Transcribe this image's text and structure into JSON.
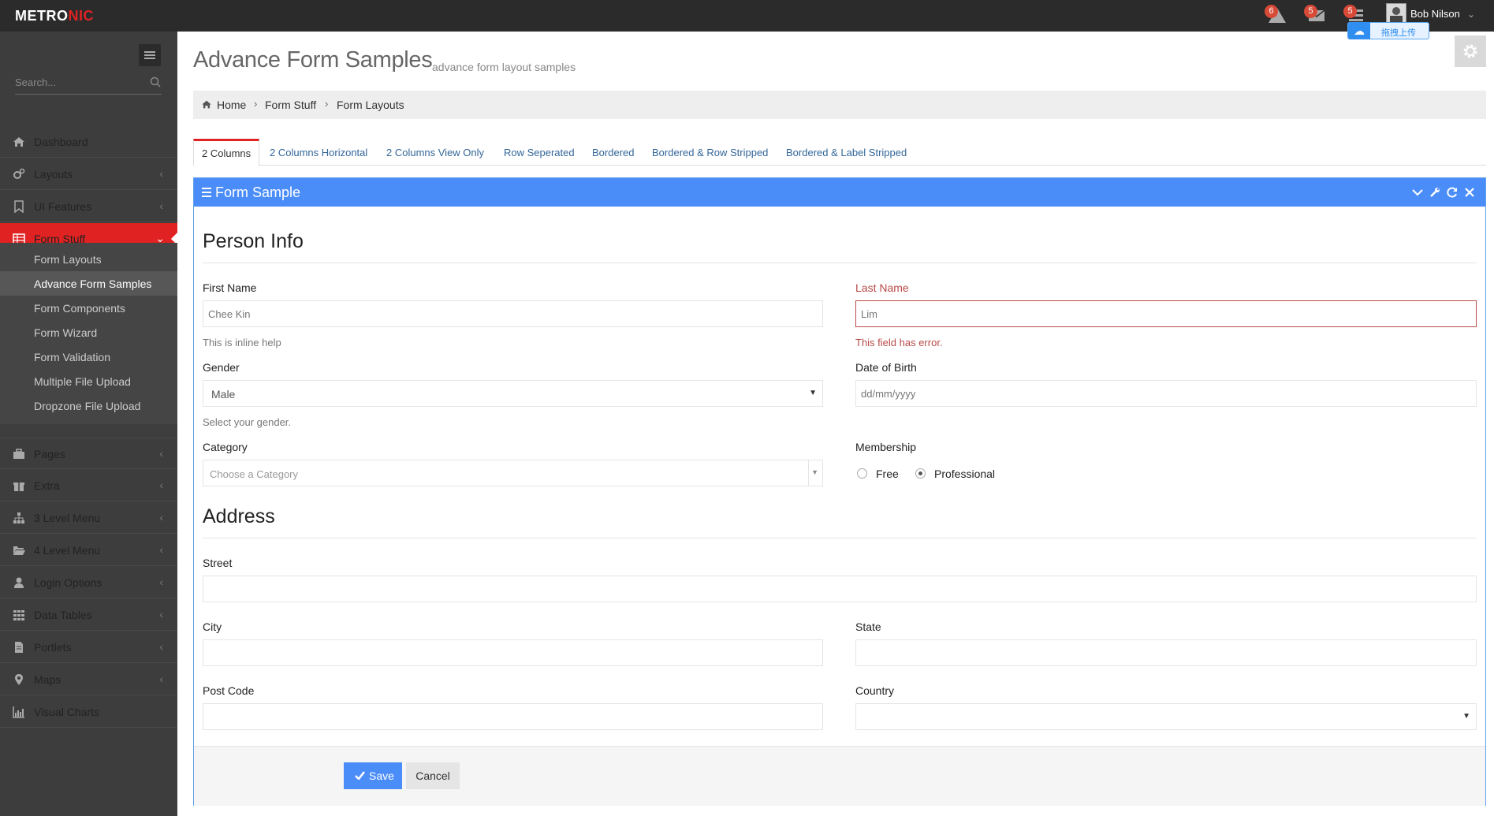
{
  "header": {
    "logo_part1": "METRO",
    "logo_part2": "NIC",
    "notifications": [
      {
        "icon": "warning-icon",
        "count": "6"
      },
      {
        "icon": "envelope-icon",
        "count": "5"
      },
      {
        "icon": "tasks-icon",
        "count": "5"
      }
    ],
    "user_name": "Bob Nilson",
    "upload_tooltip": "拖拽上传"
  },
  "sidebar": {
    "search_placeholder": "Search...",
    "items": [
      {
        "label": "Dashboard",
        "icon": "home-icon"
      },
      {
        "label": "Layouts",
        "icon": "cogs-icon"
      },
      {
        "label": "UI Features",
        "icon": "bookmark-icon"
      },
      {
        "label": "Form Stuff",
        "icon": "table-icon"
      },
      {
        "label": "Pages",
        "icon": "briefcase-icon"
      },
      {
        "label": "Extra",
        "icon": "gift-icon"
      },
      {
        "label": "3 Level Menu",
        "icon": "sitemap-icon"
      },
      {
        "label": "4 Level Menu",
        "icon": "folder-open-icon"
      },
      {
        "label": "Login Options",
        "icon": "user-icon"
      },
      {
        "label": "Data Tables",
        "icon": "th-icon"
      },
      {
        "label": "Portlets",
        "icon": "file-text-icon"
      },
      {
        "label": "Maps",
        "icon": "map-marker-icon"
      },
      {
        "label": "Visual Charts",
        "icon": "bar-chart-icon"
      }
    ],
    "submenu": [
      "Form Layouts",
      "Advance Form Samples",
      "Form Components",
      "Form Wizard",
      "Form Validation",
      "Multiple File Upload",
      "Dropzone File Upload"
    ]
  },
  "page": {
    "title": "Advance Form Samples",
    "subtitle": "advance form layout samples"
  },
  "breadcrumb": [
    "Home",
    "Form Stuff",
    "Form Layouts"
  ],
  "tabs": [
    "2 Columns",
    "2 Columns Horizontal",
    "2 Columns View Only",
    "Row Seperated",
    "Bordered",
    "Bordered & Row Stripped",
    "Bordered & Label Stripped"
  ],
  "portlet": {
    "title": "Form Sample"
  },
  "form": {
    "person_info_title": "Person Info",
    "first_name_label": "First Name",
    "first_name_placeholder": "Chee Kin",
    "first_name_help": "This is inline help",
    "last_name_label": "Last Name",
    "last_name_placeholder": "Lim",
    "last_name_help": "This field has error.",
    "gender_label": "Gender",
    "gender_value": "Male",
    "gender_help": "Select your gender.",
    "dob_label": "Date of Birth",
    "dob_placeholder": "dd/mm/yyyy",
    "category_label": "Category",
    "category_placeholder": "Choose a Category",
    "membership_label": "Membership",
    "membership_options": [
      "Free",
      "Professional"
    ],
    "membership_selected": "Professional",
    "address_title": "Address",
    "street_label": "Street",
    "city_label": "City",
    "state_label": "State",
    "postcode_label": "Post Code",
    "country_label": "Country",
    "save_label": "Save",
    "cancel_label": "Cancel"
  },
  "colors": {
    "topbar": "#2b2b2b",
    "sidebar": "#3d3d3d",
    "active_menu": "#e02222",
    "portlet_header": "#4b8df8",
    "error": "#b94a48"
  }
}
